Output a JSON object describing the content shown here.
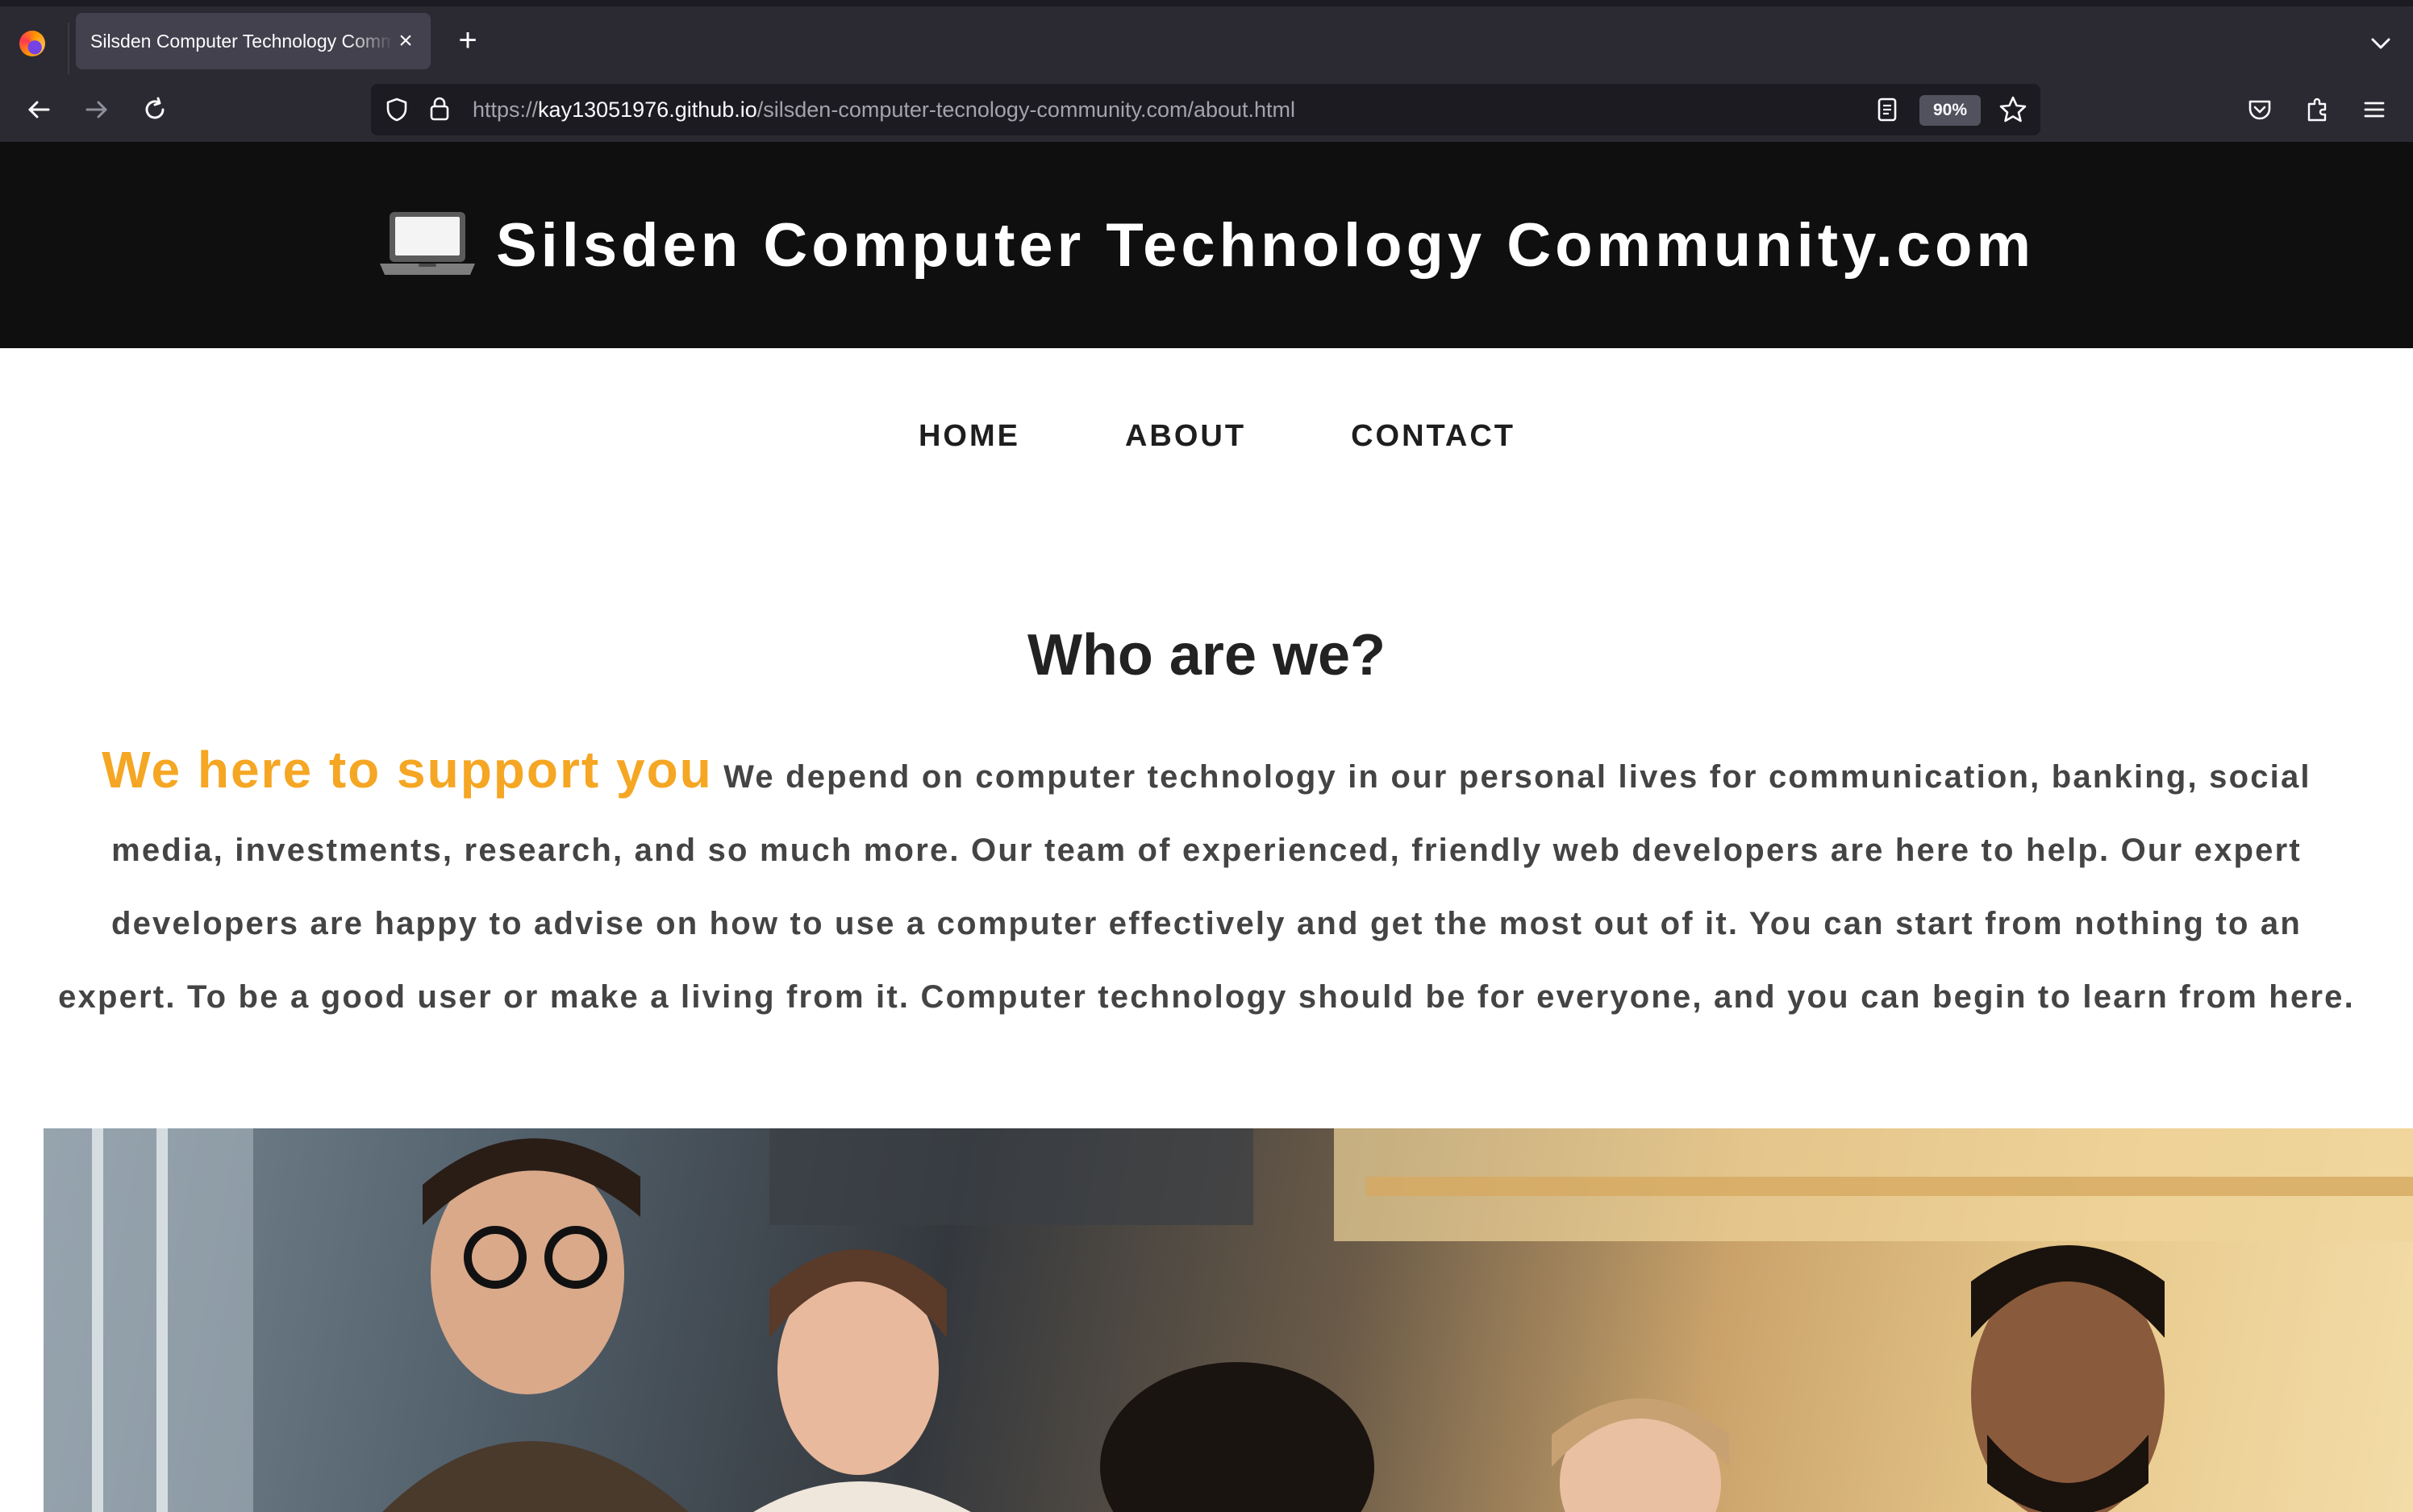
{
  "browser": {
    "tab_title": "Silsden Computer Technology Community.com",
    "url_prefix": "https://",
    "url_host": "kay13051976.github.io",
    "url_path": "/silsden-computer-tecnology-community.com/about.html",
    "zoom": "90%"
  },
  "icons": {
    "browser_logo": "firefox-logo-icon",
    "close_tab": "close-icon",
    "new_tab": "plus-icon",
    "tab_list": "chevron-down-icon",
    "back": "arrow-left-icon",
    "forward": "arrow-right-icon",
    "reload": "reload-icon",
    "tracking": "shield-icon",
    "secure": "lock-icon",
    "reader": "reader-view-icon",
    "bookmark": "star-icon",
    "pocket": "pocket-icon",
    "extensions": "puzzle-icon",
    "menu": "hamburger-menu-icon",
    "site_logo": "laptop-icon"
  },
  "site": {
    "title": "Silsden Computer Technology Community.com",
    "nav": [
      "HOME",
      "ABOUT",
      "CONTACT"
    ],
    "heading": "Who are we?",
    "highlight": "We here to support you",
    "body": "We depend on computer technology in our personal lives for communication, banking, social media, investments, research, and so much more. Our team of experienced, friendly web developers are here to help. Our expert developers are happy to advise on how to use a computer effectively and get the most out of it. You can start from nothing to an expert. To be a good user or make a living from it. Computer technology should be for everyone, and you can begin to learn from here."
  },
  "colors": {
    "header_bg": "#0f0f0f",
    "accent": "#f5a623",
    "body_text": "#444444",
    "heading_text": "#222222"
  }
}
